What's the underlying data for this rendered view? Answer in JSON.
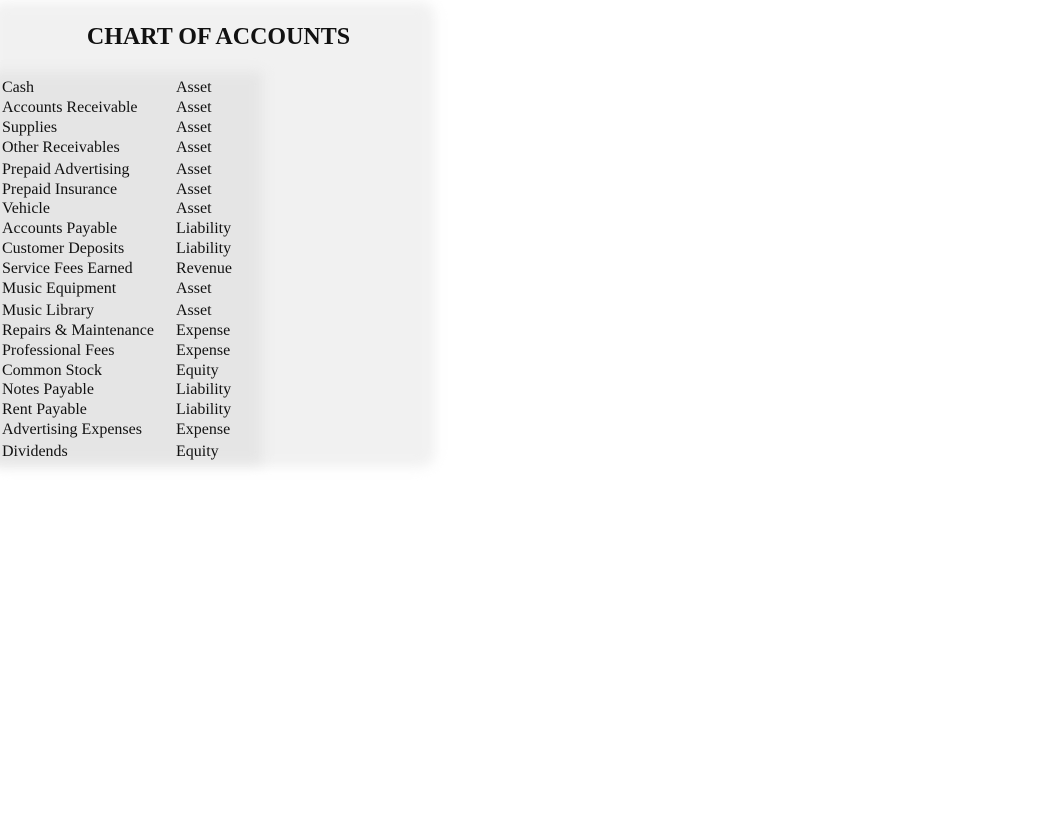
{
  "title": "CHART OF ACCOUNTS",
  "accounts": [
    {
      "name": "Cash",
      "type": "Asset"
    },
    {
      "name": "Accounts Receivable",
      "type": "Asset"
    },
    {
      "name": "Supplies",
      "type": "Asset"
    },
    {
      "name": "Other Receivables",
      "type": "Asset"
    },
    {
      "name": "Prepaid Advertising",
      "type": "Asset"
    },
    {
      "name": "Prepaid Insurance",
      "type": "Asset"
    },
    {
      "name": "Vehicle",
      "type": "Asset"
    },
    {
      "name": "Accounts Payable",
      "type": "Liability"
    },
    {
      "name": "Customer Deposits",
      "type": "Liability"
    },
    {
      "name": "Service Fees Earned",
      "type": "Revenue"
    },
    {
      "name": "Music Equipment",
      "type": "Asset"
    },
    {
      "name": "Music Library",
      "type": "Asset"
    },
    {
      "name": "Repairs & Maintenance",
      "type": "Expense"
    },
    {
      "name": "Professional Fees",
      "type": "Expense"
    },
    {
      "name": "Common Stock",
      "type": "Equity"
    },
    {
      "name": "Notes Payable",
      "type": "Liability"
    },
    {
      "name": "Rent Payable",
      "type": "Liability"
    },
    {
      "name": "Advertising Expenses",
      "type": "Expense"
    },
    {
      "name": "Dividends",
      "type": "Equity"
    }
  ]
}
